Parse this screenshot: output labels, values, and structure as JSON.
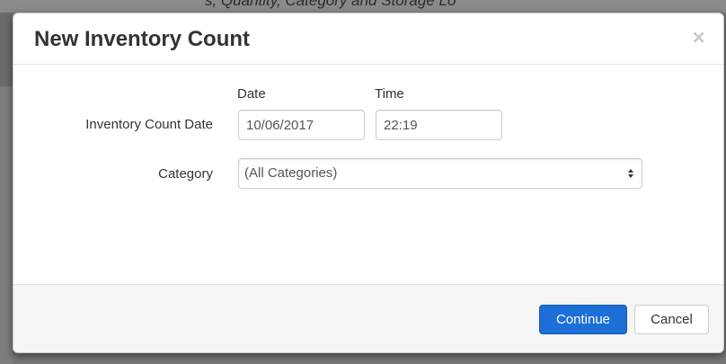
{
  "background": {
    "partial_text": "s, Quantity, Category and Storage Lo"
  },
  "dialog": {
    "title": "New Inventory Count",
    "close_symbol": "×",
    "form": {
      "date_column_header": "Date",
      "time_column_header": "Time",
      "count_date_label": "Inventory Count Date",
      "date_value": "10/06/2017",
      "time_value": "22:19",
      "category_label": "Category",
      "category_selected": "(All Categories)"
    },
    "footer": {
      "continue_label": "Continue",
      "cancel_label": "Cancel"
    }
  },
  "colors": {
    "primary": "#1b6fd6",
    "overlay": "#777777"
  }
}
